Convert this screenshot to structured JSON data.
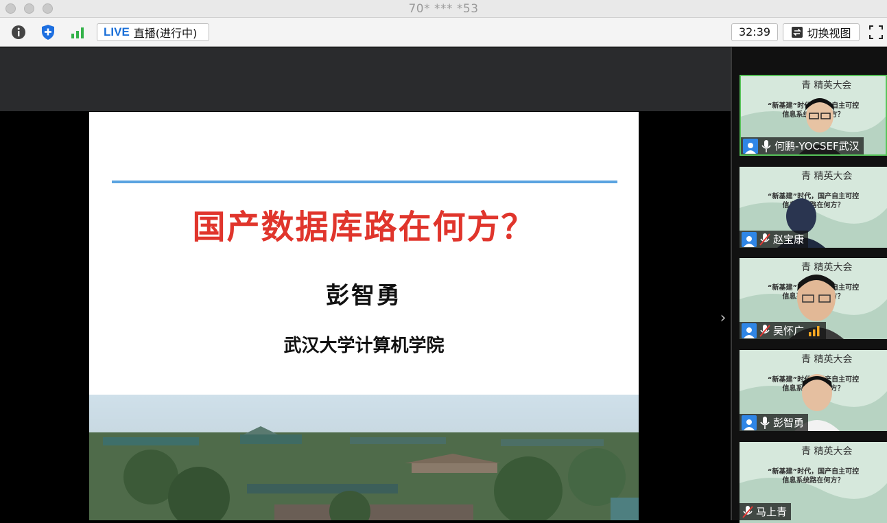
{
  "window": {
    "title": "70* *** *53"
  },
  "toolbar": {
    "live_badge": "LIVE",
    "live_status": "直播(进行中)",
    "timer": "32:39",
    "switch_view_label": "切换视图"
  },
  "slide": {
    "title": "国产数据库路在何方？",
    "author": "彭智勇",
    "affiliation": "武汉大学计算机学院"
  },
  "participants": [
    {
      "name": "何鹏-YOCSEF武汉",
      "mic": "on",
      "active": true,
      "signal": false
    },
    {
      "name": "赵宝康",
      "mic": "muted",
      "active": false,
      "signal": false
    },
    {
      "name": "吴怀广",
      "mic": "muted",
      "active": false,
      "signal": true
    },
    {
      "name": "彭智勇",
      "mic": "on",
      "active": false,
      "signal": false
    },
    {
      "name": "马上青",
      "mic": "muted",
      "active": false,
      "signal": false
    }
  ],
  "tile_banner": {
    "line1": "“新基建”时代，国产自主可控",
    "line2": "信息系统路在何方？"
  },
  "colors": {
    "live_blue": "#1a6fd8",
    "title_red": "#e0352c",
    "active_green": "#58c45a",
    "accent_line": "#5aa3e0"
  }
}
